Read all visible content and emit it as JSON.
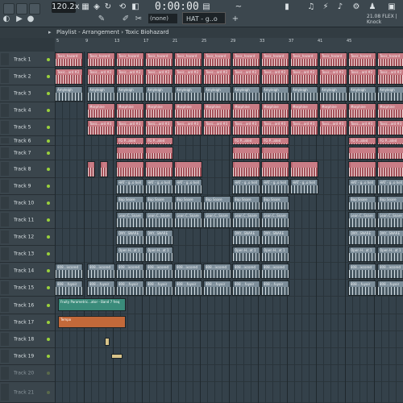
{
  "toolbar": {
    "tempo": "120.2x",
    "time": "0:00:00",
    "mode": "(none)",
    "pattern": "HAT - g..o hell",
    "cpu": "21.08  FLEX | Knock",
    "icons": [
      "record-icon",
      "metronome-icon",
      "step-icon",
      "loop-icon",
      "pattern-icon",
      "song-icon"
    ]
  },
  "playlist": {
    "title": "Playlist - Arrangement",
    "arrangement": "Toxic Biohazard",
    "ruler_labels": [
      "5",
      "9",
      "13",
      "17",
      "21",
      "25",
      "29",
      "33",
      "37",
      "41",
      "45"
    ]
  },
  "tracks": [
    {
      "label": "Track 1",
      "dim": false
    },
    {
      "label": "Track 2",
      "dim": false
    },
    {
      "label": "Track 3",
      "dim": false
    },
    {
      "label": "Track 4",
      "dim": false
    },
    {
      "label": "Track 5",
      "dim": false
    },
    {
      "label": "Track 6",
      "dim": false
    },
    {
      "label": "Track 7",
      "dim": false
    },
    {
      "label": "Track 8",
      "dim": false
    },
    {
      "label": "Track 9",
      "dim": false
    },
    {
      "label": "Track 10",
      "dim": false
    },
    {
      "label": "Track 11",
      "dim": false
    },
    {
      "label": "Track 12",
      "dim": false
    },
    {
      "label": "Track 13",
      "dim": false
    },
    {
      "label": "Track 14",
      "dim": false
    },
    {
      "label": "Track 15",
      "dim": false
    },
    {
      "label": "Track 16",
      "dim": false
    },
    {
      "label": "Track 17",
      "dim": false
    },
    {
      "label": "Track 18",
      "dim": false
    },
    {
      "label": "Track 19",
      "dim": false
    },
    {
      "label": "Track 20",
      "dim": true
    },
    {
      "label": "Track 21",
      "dim": true
    }
  ],
  "clips": [
    {
      "track": 0,
      "label": "Toxic_hazard",
      "color": "red",
      "starts": [
        0,
        40,
        76,
        112,
        148,
        184,
        220,
        256,
        292,
        328,
        364,
        400
      ]
    },
    {
      "track": 1,
      "label": "Toxic...ard #2",
      "color": "red",
      "starts": [
        0,
        40,
        76,
        112,
        148,
        184,
        220,
        256,
        292,
        328,
        364,
        400
      ]
    },
    {
      "track": 2,
      "label": "Amyleigh",
      "color": "grey",
      "starts": [
        0,
        40,
        76,
        112,
        148,
        184,
        220,
        256,
        292,
        328,
        364,
        400
      ]
    },
    {
      "track": 3,
      "label": "Morphine",
      "color": "red",
      "starts": [
        40,
        76,
        112,
        148,
        184,
        220,
        256,
        292,
        328,
        364,
        400
      ]
    },
    {
      "track": 4,
      "label": "Toxic...ard #3",
      "color": "red",
      "starts": [
        40,
        76,
        112,
        148,
        184,
        220,
        256,
        292,
        328,
        364,
        400
      ]
    },
    {
      "track": 5,
      "label": "FG P...ated",
      "color": "red",
      "starts": [
        76,
        112,
        220,
        256,
        364,
        400
      ]
    },
    {
      "track": 6,
      "label": "",
      "color": "red",
      "starts": [
        76,
        112,
        220,
        256,
        364,
        400
      ]
    },
    {
      "track": 7,
      "label": "",
      "color": "red",
      "starts": [
        40,
        56,
        76,
        112,
        148,
        220,
        256,
        292,
        364,
        400
      ]
    },
    {
      "track": 8,
      "label": "HAT - g..o hell",
      "color": "grey",
      "starts": [
        76,
        112,
        148,
        220,
        256,
        292,
        364,
        400
      ]
    },
    {
      "track": 9,
      "label": "Bop Snare",
      "color": "grey",
      "starts": [
        76,
        112,
        148,
        184,
        220,
        256,
        364,
        400
      ]
    },
    {
      "track": 10,
      "label": "Lean C..Snare",
      "color": "grey",
      "starts": [
        76,
        112,
        148,
        184,
        220,
        256,
        364,
        400
      ]
    },
    {
      "track": 11,
      "label": "DNY...SNARE",
      "color": "grey",
      "starts": [
        76,
        112,
        220,
        256,
        364,
        400
      ]
    },
    {
      "track": 12,
      "label": "Open H...at 1",
      "color": "grey",
      "starts": [
        76,
        112,
        220,
        256,
        364,
        400
      ]
    },
    {
      "track": 13,
      "label": "808...ixcored",
      "color": "grey",
      "starts": [
        0,
        40,
        76,
        112,
        148,
        184,
        220,
        256,
        364,
        400
      ]
    },
    {
      "track": 14,
      "label": "808 ...fuyoir",
      "color": "grey",
      "starts": [
        0,
        40,
        76,
        112,
        148,
        184,
        220,
        256,
        364,
        400
      ]
    }
  ],
  "automation": [
    {
      "track": 15,
      "label": "Fruity Parametric...ator - Band 7 freq",
      "color": "#3a8b7a"
    },
    {
      "track": 16,
      "label": "Tempo",
      "color": "#c2693a"
    }
  ],
  "colors": {
    "red_clip": "#b9666f",
    "grey_clip": "#5a6b77",
    "active_dot": "#9ad13c"
  }
}
